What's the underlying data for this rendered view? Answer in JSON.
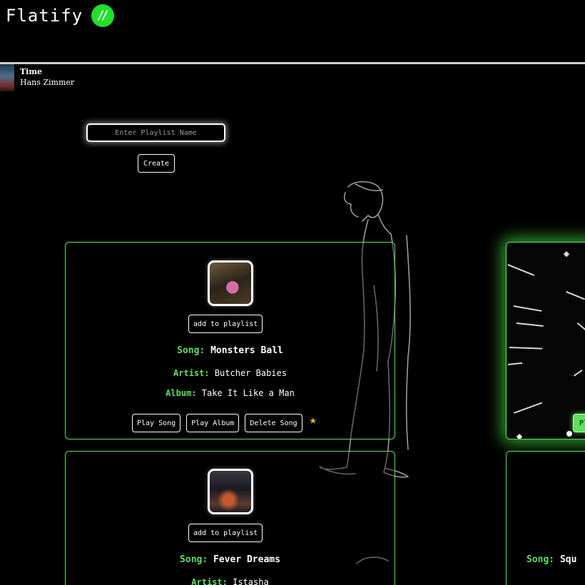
{
  "app": {
    "title": "Flatify",
    "logo_glyph": "//",
    "accent": "#5fe05f",
    "logo_color": "#22e02a"
  },
  "now_playing": {
    "title": "Time",
    "artist": "Hans Zimmer",
    "art_icon": "album-cover"
  },
  "playlist_form": {
    "placeholder": "Enter Playlist Name",
    "create_label": "Create"
  },
  "labels": {
    "add_to_playlist": "add to playlist",
    "song": "Song:",
    "artist": "Artist:",
    "album": "Album:",
    "play_song": "Play Song",
    "play_album": "Play Album",
    "delete_song": "Delete Song",
    "star": "★",
    "play_partial": "Pl"
  },
  "songs": [
    {
      "song": "Monsters Ball",
      "artist": "Butcher Babies",
      "album": "Take It Like a Man",
      "favorite": true
    },
    {
      "song": "Fever Dreams",
      "artist": "Istasha"
    },
    {
      "song": ""
    },
    {
      "song": "Squ"
    }
  ]
}
